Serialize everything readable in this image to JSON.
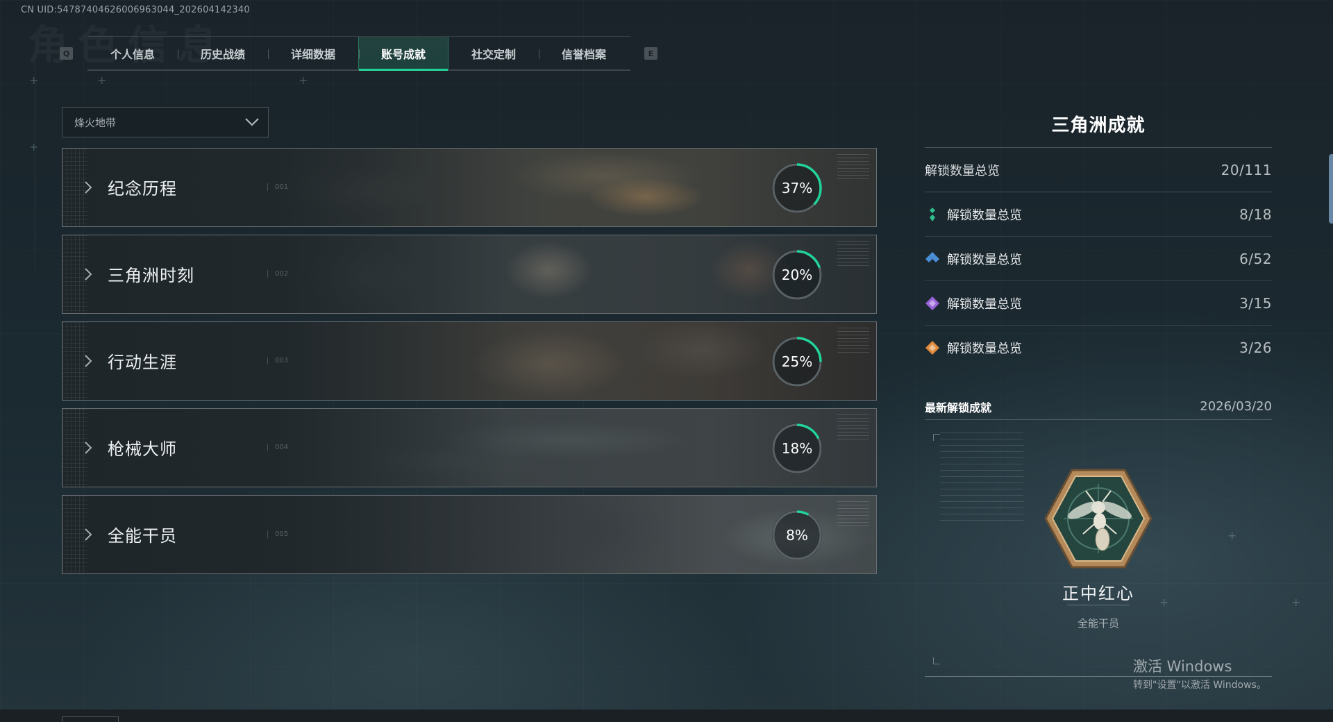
{
  "header": {
    "uid": "CN UID:5478740462600696304​4_202604142340",
    "bg_title": "角色信息",
    "key_left": "Q",
    "key_right": "E"
  },
  "tabs": [
    {
      "label": "个人信息",
      "active": false
    },
    {
      "label": "历史战绩",
      "active": false
    },
    {
      "label": "详细数据",
      "active": false
    },
    {
      "label": "账号成就",
      "active": true
    },
    {
      "label": "社交定制",
      "active": false
    },
    {
      "label": "信誉档案",
      "active": false
    }
  ],
  "mode_select": {
    "value": "烽火地带"
  },
  "categories": [
    {
      "name": "纪念历程",
      "index": "001",
      "percent_label": "37%",
      "progress": 0.37
    },
    {
      "name": "三角洲时刻",
      "index": "002",
      "percent_label": "20%",
      "progress": 0.2
    },
    {
      "name": "行动生涯",
      "index": "003",
      "percent_label": "25%",
      "progress": 0.25
    },
    {
      "name": "枪械大师",
      "index": "004",
      "percent_label": "18%",
      "progress": 0.18
    },
    {
      "name": "全能干员",
      "index": "005",
      "percent_label": "8%",
      "progress": 0.08
    }
  ],
  "panel": {
    "title": "三角洲成就",
    "total": {
      "label": "解锁数量总览",
      "value": "20/111"
    },
    "tiers": [
      {
        "label": "解锁数量总览",
        "value": "8/18",
        "icon": "green-gem-icon",
        "color": "#2fbf8f"
      },
      {
        "label": "解锁数量总览",
        "value": "6/52",
        "icon": "blue-gem-icon",
        "color": "#4a8fd8"
      },
      {
        "label": "解锁数量总览",
        "value": "3/15",
        "icon": "purple-gem-icon",
        "color": "#9a62d8"
      },
      {
        "label": "解锁数量总览",
        "value": "3/26",
        "icon": "orange-gem-icon",
        "color": "#e08a3c"
      }
    ],
    "latest": {
      "heading": "最新解锁成就",
      "date": "2026/03/20",
      "name": "正中红心",
      "category": "全能干员",
      "badge_icon": "wasp-badge-icon"
    }
  },
  "watermark": {
    "line1": "激活 Windows",
    "line2": "转到\"设置\"以激活 Windows。"
  },
  "colors": {
    "accent": "#22d39a",
    "ring_track": "#5a6266"
  }
}
